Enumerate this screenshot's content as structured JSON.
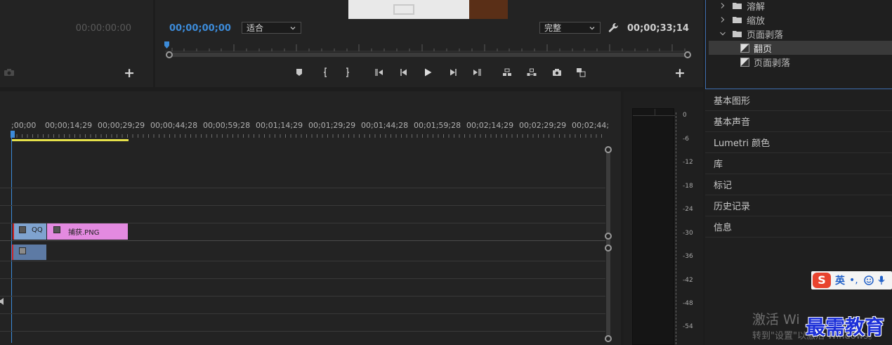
{
  "source_monitor": {
    "timecode": "00:00:00:00"
  },
  "program_monitor": {
    "current_timecode": "00;00;00;00",
    "fit_dropdown": "适合",
    "quality_dropdown": "完整",
    "duration_timecode": "00;00;33;14"
  },
  "effects_tree": [
    {
      "label": "溶解",
      "type": "folder",
      "expanded": false
    },
    {
      "label": "缩放",
      "type": "folder",
      "expanded": false
    },
    {
      "label": "页面剥落",
      "type": "folder",
      "expanded": true
    },
    {
      "label": "翻页",
      "type": "effect",
      "selected": true
    },
    {
      "label": "页面剥落",
      "type": "effect",
      "selected": false
    }
  ],
  "timeline": {
    "ruler_labels": [
      ";00;00",
      "00;00;14;29",
      "00;00;29;29",
      "00;00;44;28",
      "00;00;59;28",
      "00;01;14;29",
      "00;01;29;29",
      "00;01;44;28",
      "00;01;59;28",
      "00;02;14;29",
      "00;02;29;29",
      "00;02;44;"
    ],
    "clips": {
      "qq": "QQ",
      "png": "捕获.PNG"
    }
  },
  "audio_meter": {
    "scale": [
      "0",
      "-6",
      "-12",
      "-18",
      "-24",
      "-30",
      "-36",
      "-42",
      "-48",
      "-54"
    ]
  },
  "panels": [
    "基本图形",
    "基本声音",
    "Lumetri 颜色",
    "库",
    "标记",
    "历史记录",
    "信息"
  ],
  "ime": {
    "logo": "S",
    "mode": "英",
    "punct": "•,"
  },
  "os_notice": {
    "title": "激活 Wi",
    "subtitle": "转到\"设置\"以激活 Windows。"
  },
  "watermark": "最需教育",
  "colors": {
    "accent_blue": "#3c8bd9",
    "clip_video": "#7fa3cf",
    "clip_image": "#e38ae0",
    "workarea": "#e6e14a"
  }
}
